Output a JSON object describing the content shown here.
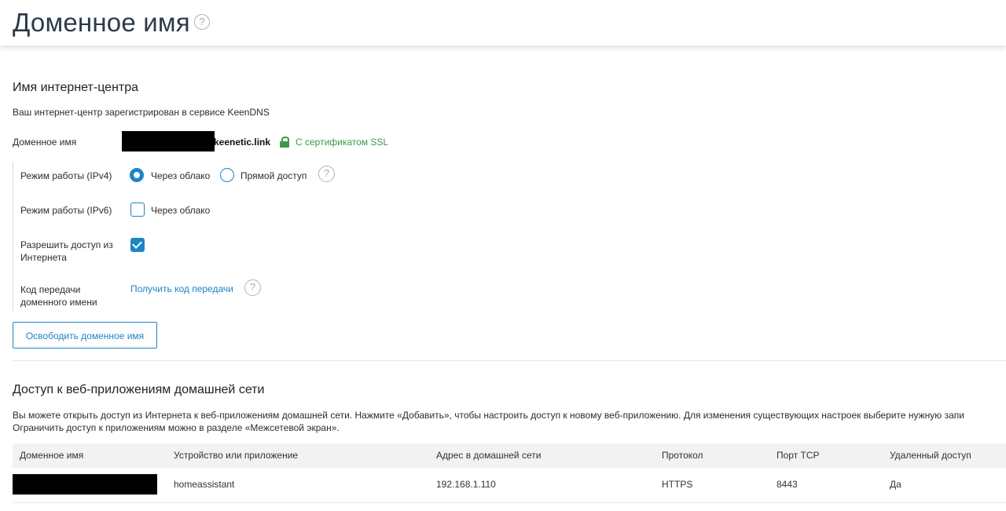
{
  "page": {
    "title": "Доменное имя",
    "help": "?"
  },
  "router_name": {
    "heading": "Имя интернет-центра",
    "description": "Ваш интернет-центр зарегистрирован в сервисе KeenDNS",
    "domain_label": "Доменное имя",
    "domain_suffix": "keenetic.link",
    "ssl_text": "С сертификатом SSL",
    "ipv4": {
      "label": "Режим работы (IPv4)",
      "options": [
        "Через облако",
        "Прямой доступ"
      ],
      "selected": "Через облако"
    },
    "ipv6": {
      "label": "Режим работы (IPv6)",
      "option": "Через облако",
      "checked": false
    },
    "internet_access": {
      "label_line1": "Разрешить доступ из",
      "label_line2": "Интернета",
      "checked": true
    },
    "transfer_code": {
      "label_line1": "Код передачи",
      "label_line2": "доменного имени",
      "link": "Получить код передачи"
    },
    "release_button": "Освободить доменное имя"
  },
  "web_apps": {
    "heading": "Доступ к веб-приложениям домашней сети",
    "description_line1": "Вы можете открыть доступ из Интернета к веб-приложениям домашней сети. Нажмите «Добавить», чтобы настроить доступ к новому веб-приложению. Для изменения существующих настроек выберите нужную запи",
    "description_line2": "Ограничить доступ к приложениям можно в разделе «Межсетевой экран».",
    "columns": [
      "Доменное имя",
      "Устройство или приложение",
      "Адрес в домашней сети",
      "Протокол",
      "Порт TCP",
      "Удаленный доступ"
    ],
    "rows": [
      {
        "device": "homeassistant",
        "address": "192.168.1.110",
        "protocol": "HTTPS",
        "port": "8443",
        "remote": "Да"
      }
    ]
  },
  "colors": {
    "accent": "#1e84c6",
    "ssl_green": "#3a9a46",
    "title": "#2b3a48"
  }
}
